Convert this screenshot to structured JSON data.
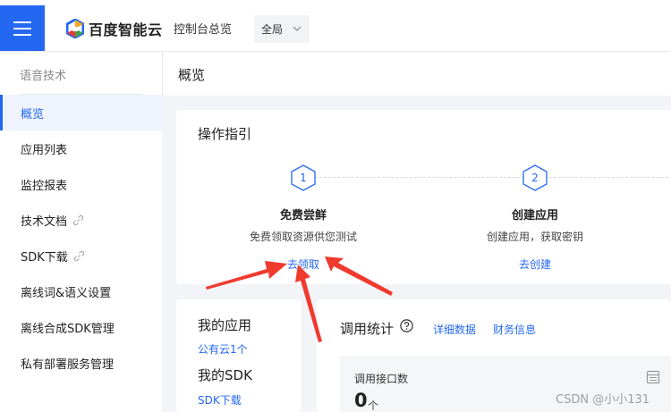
{
  "header": {
    "brand": "百度智能云",
    "nav_overview": "控制台总览",
    "region": "全局"
  },
  "sidebar": {
    "title": "语音技术",
    "items": [
      {
        "label": "概览",
        "active": true
      },
      {
        "label": "应用列表"
      },
      {
        "label": "监控报表"
      },
      {
        "label": "技术文档",
        "external": true
      },
      {
        "label": "SDK下载",
        "external": true
      },
      {
        "label": "离线词&语义设置"
      },
      {
        "label": "离线合成SDK管理"
      },
      {
        "label": "私有部署服务管理"
      }
    ]
  },
  "main": {
    "title": "概览",
    "guide": {
      "title": "操作指引",
      "steps": [
        {
          "num": "1",
          "title": "免费尝鲜",
          "desc": "免费领取资源供您测试",
          "link": "去领取"
        },
        {
          "num": "2",
          "title": "创建应用",
          "desc": "创建应用，获取密钥",
          "link": "去创建"
        }
      ]
    },
    "myapp": {
      "apps_title": "我的应用",
      "apps_link": "公有云1个",
      "sdk_title": "我的SDK",
      "sdk_link": "SDK下载"
    },
    "stats": {
      "title": "调用统计",
      "tab_detail": "详细数据",
      "tab_finance": "财务信息",
      "metric_label": "调用接口数",
      "metric_value": "0",
      "metric_unit": "个"
    }
  },
  "watermark": "CSDN @小小131",
  "colors": {
    "accent": "#2468f2",
    "annotation_arrow": "#f03a2e"
  }
}
